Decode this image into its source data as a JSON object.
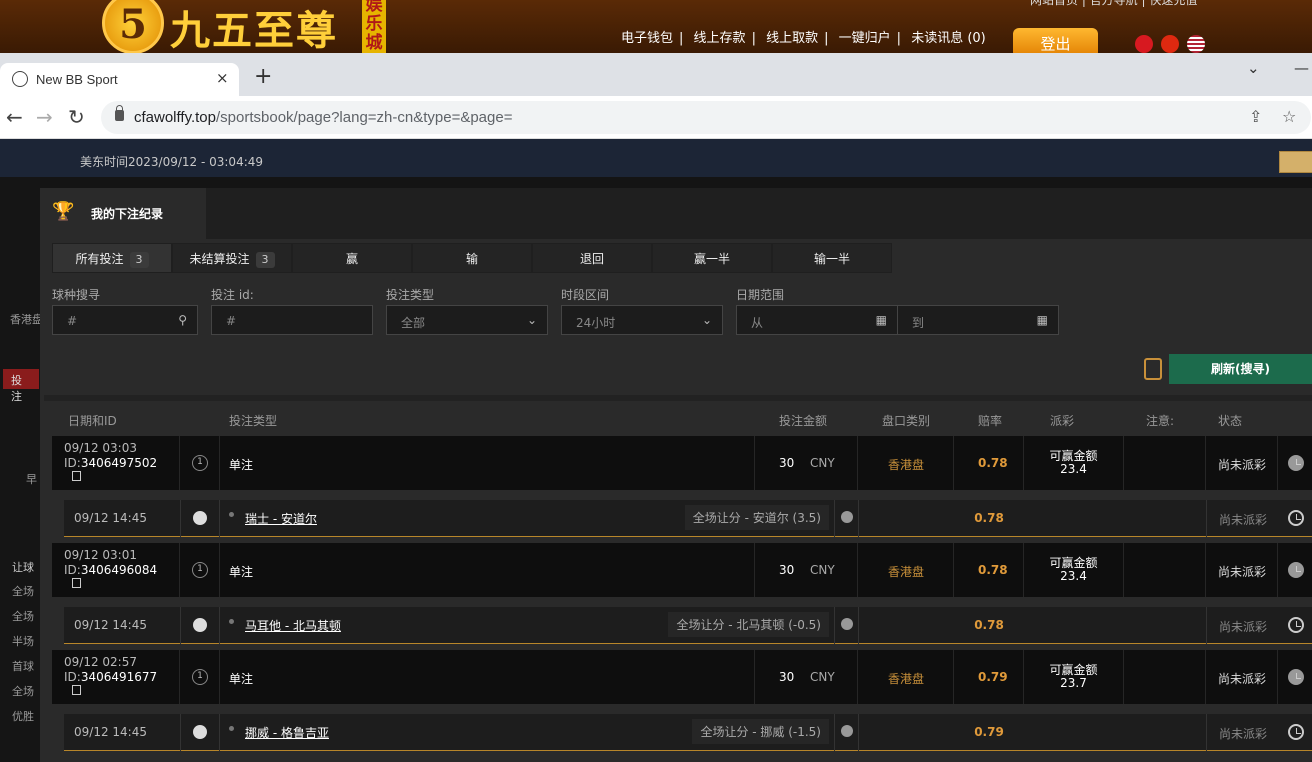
{
  "site": {
    "logo_digit": "5",
    "logo_text": "九五至尊",
    "logo_sub": "娱乐城",
    "top_links": [
      "电子钱包",
      "线上存款",
      "线上取款",
      "一键归户",
      "未读讯息 (0)"
    ],
    "top_links_partial": "网站首页 | 官方导航 | 快速充值",
    "logout_label": "登出"
  },
  "browser": {
    "tab_title": "New BB Sport",
    "tab_close": "×",
    "new_tab": "+",
    "url_domain": "cfawolffy.top",
    "url_path": "/sportsbook/page?lang=zh-cn&type=&page="
  },
  "page": {
    "time_label": "美东时间2023/09/12 - 03:04:49"
  },
  "left_menu": [
    "香港盘",
    "投注",
    "早",
    "让球",
    "全场",
    "全场",
    "半场",
    "首球",
    "全场",
    "优胜"
  ],
  "modal": {
    "title": "我的下注纪录",
    "tabs": [
      {
        "label": "所有投注",
        "count": "3"
      },
      {
        "label": "未结算投注",
        "count": "3"
      },
      {
        "label": "赢"
      },
      {
        "label": "输"
      },
      {
        "label": "退回"
      },
      {
        "label": "赢一半"
      },
      {
        "label": "输一半"
      }
    ],
    "filters": {
      "sport_label": "球种搜寻",
      "sport_placeholder": "#",
      "betid_label": "投注 id:",
      "betid_placeholder": "#",
      "bettype_label": "投注类型",
      "bettype_value": "全部",
      "period_label": "时段区间",
      "period_value": "24小时",
      "daterange_label": "日期范围",
      "from_placeholder": "从",
      "to_placeholder": "到"
    },
    "refresh_label": "刷新(搜寻)",
    "columns": [
      "日期和ID",
      "投注类型",
      "投注金额",
      "盘口类别",
      "赔率",
      "派彩",
      "注意:",
      "状态"
    ],
    "bets": [
      {
        "date": "09/12 03:03",
        "id_prefix": "ID:",
        "id": "3406497502",
        "type": "单注",
        "amount": "30",
        "currency": "CNY",
        "market": "香港盘",
        "odds": "0.78",
        "payout_label": "可赢金额",
        "payout": "23.4",
        "status": "尚未派彩",
        "leg": {
          "time": "09/12 14:45",
          "match": "瑞士 - 安道尔",
          "selection": "全场让分 - 安道尔 (3.5)",
          "odds": "0.78",
          "status": "尚未派彩"
        }
      },
      {
        "date": "09/12 03:01",
        "id_prefix": "ID:",
        "id": "3406496084",
        "type": "单注",
        "amount": "30",
        "currency": "CNY",
        "market": "香港盘",
        "odds": "0.78",
        "payout_label": "可赢金额",
        "payout": "23.4",
        "status": "尚未派彩",
        "leg": {
          "time": "09/12 14:45",
          "match": "马耳他 - 北马其顿",
          "selection": "全场让分 - 北马其顿 (-0.5)",
          "odds": "0.78",
          "status": "尚未派彩"
        }
      },
      {
        "date": "09/12 02:57",
        "id_prefix": "ID:",
        "id": "3406491677",
        "type": "单注",
        "amount": "30",
        "currency": "CNY",
        "market": "香港盘",
        "odds": "0.79",
        "payout_label": "可赢金额",
        "payout": "23.7",
        "status": "尚未派彩",
        "leg": {
          "time": "09/12 14:45",
          "match": "挪威 - 格鲁吉亚",
          "selection": "全场让分 - 挪威 (-1.5)",
          "odds": "0.79",
          "status": "尚未派彩"
        }
      }
    ]
  },
  "icons": {
    "bet_type_icon": "1"
  }
}
